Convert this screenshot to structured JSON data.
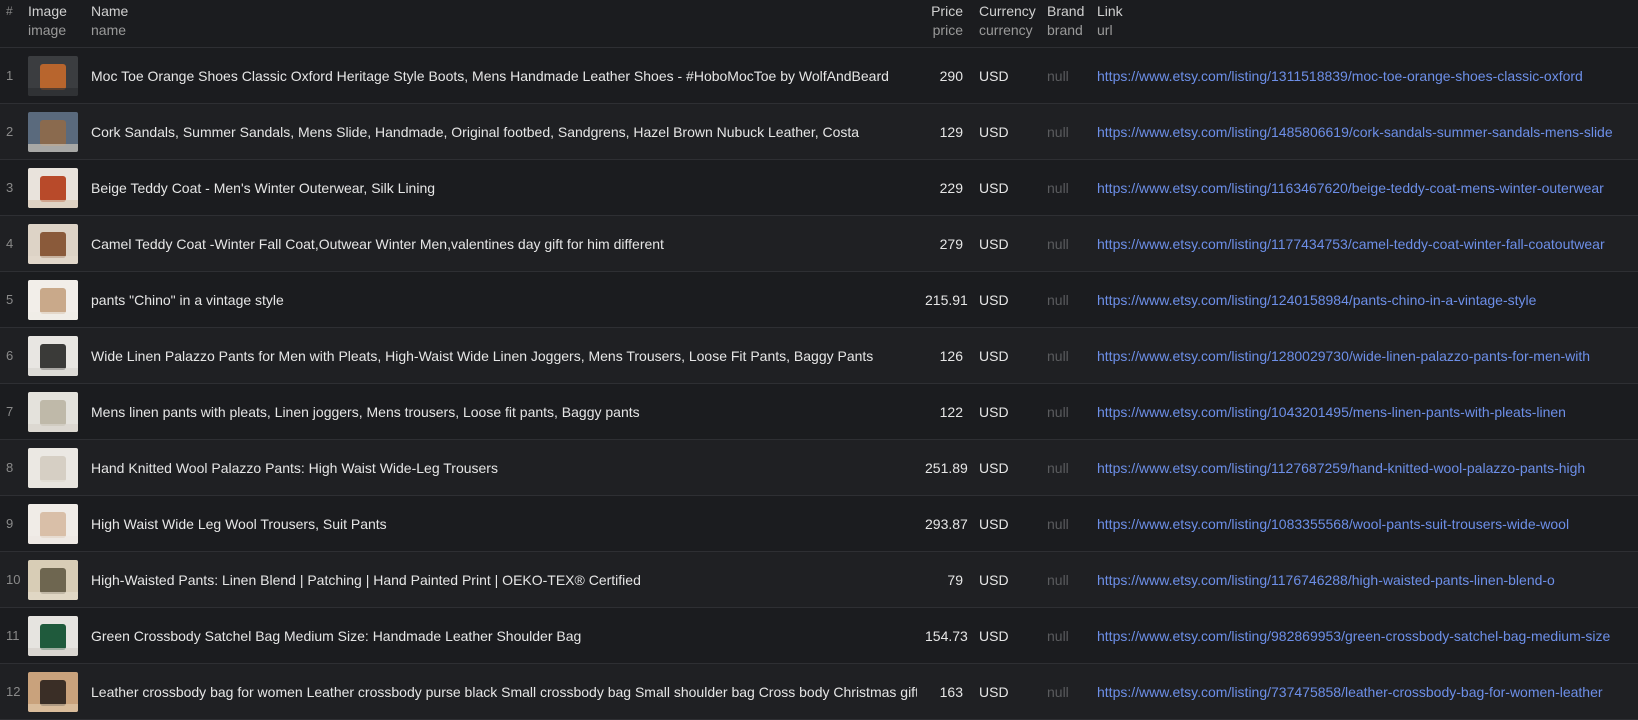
{
  "columns": [
    {
      "key": "idx",
      "label": "#",
      "sub": ""
    },
    {
      "key": "image",
      "label": "Image",
      "sub": "image"
    },
    {
      "key": "name",
      "label": "Name",
      "sub": "name"
    },
    {
      "key": "price",
      "label": "Price",
      "sub": "price"
    },
    {
      "key": "currency",
      "label": "Currency",
      "sub": "currency"
    },
    {
      "key": "brand",
      "label": "Brand",
      "sub": "brand"
    },
    {
      "key": "link",
      "label": "Link",
      "sub": "url"
    }
  ],
  "rows": [
    {
      "idx": "1",
      "name": "Moc Toe Orange Shoes Classic Oxford Heritage Style Boots, Mens Handmade Leather Shoes - #HoboMocToe by WolfAndBeard",
      "price": "290",
      "currency": "USD",
      "brand": "null",
      "link": "https://www.etsy.com/listing/1311518839/moc-toe-orange-shoes-classic-oxford",
      "thumb_colors": [
        "#3b3d40",
        "#b8652d",
        "#2c2d30"
      ]
    },
    {
      "idx": "2",
      "name": "Cork Sandals, Summer Sandals, Mens Slide, Handmade, Original footbed, Sandgrens, Hazel Brown Nubuck Leather, Costa",
      "price": "129",
      "currency": "USD",
      "brand": "null",
      "link": "https://www.etsy.com/listing/1485806619/cork-sandals-summer-sandals-mens-slide",
      "thumb_colors": [
        "#5a6a7d",
        "#8a6a4e",
        "#c9c3b8"
      ]
    },
    {
      "idx": "3",
      "name": "Beige Teddy Coat - Men's Winter Outerwear, Silk Lining",
      "price": "229",
      "currency": "USD",
      "brand": "null",
      "link": "https://www.etsy.com/listing/1163467620/beige-teddy-coat-mens-winter-outerwear",
      "thumb_colors": [
        "#e9e3dc",
        "#b84a2a",
        "#d8cbb8"
      ]
    },
    {
      "idx": "4",
      "name": "Camel Teddy Coat -Winter Fall Coat,Outwear Winter Men,valentines day gift for him different",
      "price": "279",
      "currency": "USD",
      "brand": "null",
      "link": "https://www.etsy.com/listing/1177434753/camel-teddy-coat-winter-fall-coatoutwear",
      "thumb_colors": [
        "#ddd3c6",
        "#8a5a3a",
        "#e2d8cc"
      ]
    },
    {
      "idx": "5",
      "name": "pants \"Chino\" in a vintage style",
      "price": "215.91",
      "currency": "USD",
      "brand": "null",
      "link": "https://www.etsy.com/listing/1240158984/pants-chino-in-a-vintage-style",
      "thumb_colors": [
        "#f2eee9",
        "#c9a98a",
        "#f0ece6"
      ]
    },
    {
      "idx": "6",
      "name": "Wide Linen Palazzo Pants for Men with Pleats, High-Waist Wide Linen Joggers, Mens Trousers, Loose Fit Pants, Baggy Pants",
      "price": "126",
      "currency": "USD",
      "brand": "null",
      "link": "https://www.etsy.com/listing/1280029730/wide-linen-palazzo-pants-for-men-with",
      "thumb_colors": [
        "#e8e6e2",
        "#3a3a38",
        "#d8d6d2"
      ]
    },
    {
      "idx": "7",
      "name": "Mens linen pants with pleats, Linen joggers, Mens trousers, Loose fit pants, Baggy pants",
      "price": "122",
      "currency": "USD",
      "brand": "null",
      "link": "https://www.etsy.com/listing/1043201495/mens-linen-pants-with-pleats-linen",
      "thumb_colors": [
        "#e4e2dc",
        "#bfb9a9",
        "#d8d4cc"
      ]
    },
    {
      "idx": "8",
      "name": "Hand Knitted Wool Palazzo Pants: High Waist Wide-Leg Trousers",
      "price": "251.89",
      "currency": "USD",
      "brand": "null",
      "link": "https://www.etsy.com/listing/1127687259/hand-knitted-wool-palazzo-pants-high",
      "thumb_colors": [
        "#ebe8e3",
        "#d6cfc4",
        "#e6e2dc"
      ]
    },
    {
      "idx": "9",
      "name": "High Waist Wide Leg Wool Trousers, Suit Pants",
      "price": "293.87",
      "currency": "USD",
      "brand": "null",
      "link": "https://www.etsy.com/listing/1083355568/wool-pants-suit-trousers-wide-wool",
      "thumb_colors": [
        "#f0ece7",
        "#d9bfa8",
        "#ece8e2"
      ]
    },
    {
      "idx": "10",
      "name": "High-Waisted Pants: Linen Blend | Patching | Hand Painted Print | OEKO-TEX® Certified",
      "price": "79",
      "currency": "USD",
      "brand": "null",
      "link": "https://www.etsy.com/listing/1176746288/high-waisted-pants-linen-blend-o",
      "thumb_colors": [
        "#d8cdb6",
        "#6e6650",
        "#e4dccb"
      ]
    },
    {
      "idx": "11",
      "name": "Green Crossbody Satchel Bag Medium Size: Handmade Leather Shoulder Bag",
      "price": "154.73",
      "currency": "USD",
      "brand": "null",
      "link": "https://www.etsy.com/listing/982869953/green-crossbody-satchel-bag-medium-size",
      "thumb_colors": [
        "#e6e4e0",
        "#1f5a3c",
        "#d4d0ca"
      ]
    },
    {
      "idx": "12",
      "name": "Leather crossbody bag for women Leather crossbody purse black Small crossbody bag Small shoulder bag Cross body Christmas gift",
      "price": "163",
      "currency": "USD",
      "brand": "null",
      "link": "https://www.etsy.com/listing/737475858/leather-crossbody-bag-for-women-leather",
      "thumb_colors": [
        "#c9a27c",
        "#3a2e26",
        "#e0c8a8"
      ]
    }
  ]
}
